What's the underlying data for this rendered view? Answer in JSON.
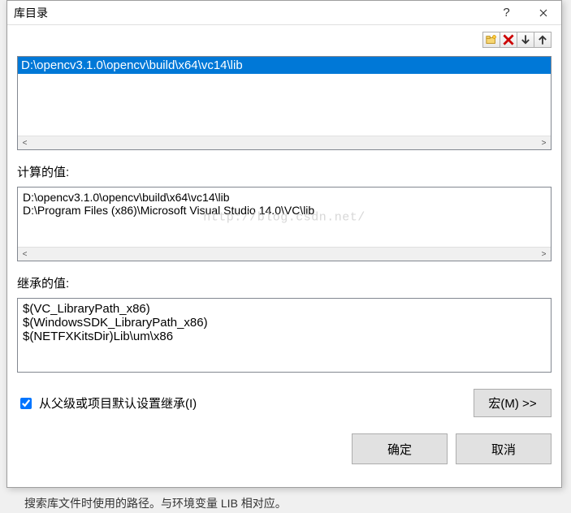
{
  "window": {
    "title": "库目录"
  },
  "toolbar": {
    "new_folder_icon": "new-folder-icon",
    "delete_icon": "delete-icon",
    "move_down_icon": "arrow-down-icon",
    "move_up_icon": "arrow-up-icon"
  },
  "paths": {
    "entries": [
      "D:\\opencv3.1.0\\opencv\\build\\x64\\vc14\\lib"
    ],
    "selected_index": 0
  },
  "evaluated": {
    "label": "计算的值:",
    "lines": [
      "D:\\opencv3.1.0\\opencv\\build\\x64\\vc14\\lib",
      "D:\\Program Files (x86)\\Microsoft Visual Studio 14.0\\VC\\lib"
    ]
  },
  "inherited": {
    "label": "继承的值:",
    "lines": [
      "$(VC_LibraryPath_x86)",
      "$(WindowsSDK_LibraryPath_x86)",
      "$(NETFXKitsDir)Lib\\um\\x86"
    ]
  },
  "inherit_checkbox": {
    "label": "从父级或项目默认设置继承(I)",
    "checked": true
  },
  "buttons": {
    "macros": "宏(M) >>",
    "ok": "确定",
    "cancel": "取消"
  },
  "watermark": "http://blog.csdn.net/",
  "background_snippet": "搜索库文件时使用的路径。与环境变量 LIB 相对应。"
}
